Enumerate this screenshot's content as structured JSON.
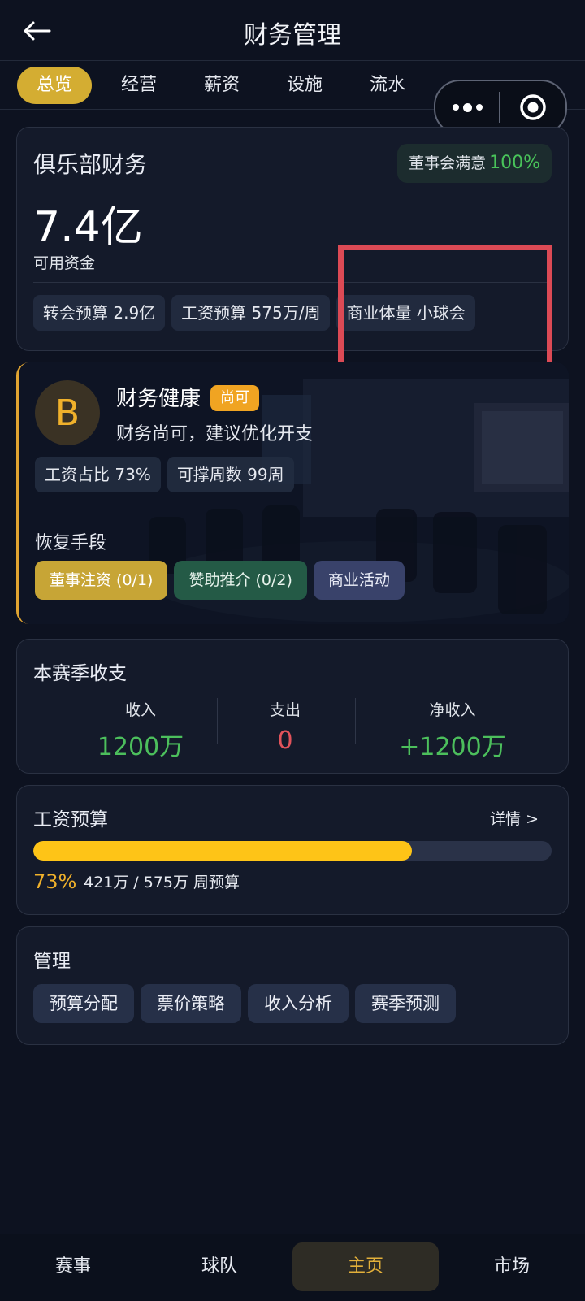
{
  "header": {
    "title": "财务管理"
  },
  "tabs": [
    {
      "label": "总览",
      "active": true
    },
    {
      "label": "经营"
    },
    {
      "label": "薪资"
    },
    {
      "label": "设施"
    },
    {
      "label": "流水"
    }
  ],
  "finance": {
    "title": "俱乐部财务",
    "board_label": "董事会满意",
    "board_value": "100%",
    "amount": "7.4亿",
    "amount_label": "可用资金",
    "chips": [
      "转会预算 2.9亿",
      "工资预算 575万/周",
      "商业体量 小球会"
    ]
  },
  "health": {
    "grade": "B",
    "title": "财务健康",
    "badge": "尚可",
    "desc": "财务尚可，建议优化开支",
    "chips": [
      "工资占比 73%",
      "可撑周数 99周"
    ],
    "recovery_title": "恢复手段",
    "actions": [
      "董事注资 (0/1)",
      "赞助推介 (0/2)",
      "商业活动"
    ]
  },
  "season": {
    "title": "本赛季收支",
    "income_label": "收入",
    "income": "1200万",
    "expense_label": "支出",
    "expense": "0",
    "net_label": "净收入",
    "net": "+1200万",
    "colors": {
      "income": "#4cbf5c",
      "expense": "#e2535b",
      "net": "#4cbf5c"
    }
  },
  "wage": {
    "title": "工资预算",
    "detail": "详情 >",
    "ratio": 0.73,
    "pct": "73%",
    "text": "421万 / 575万 周预算"
  },
  "manage": {
    "title": "管理",
    "buttons": [
      "预算分配",
      "票价策略",
      "收入分析",
      "赛季预测"
    ]
  },
  "nav": [
    "赛事",
    "球队",
    "主页",
    "市场"
  ]
}
